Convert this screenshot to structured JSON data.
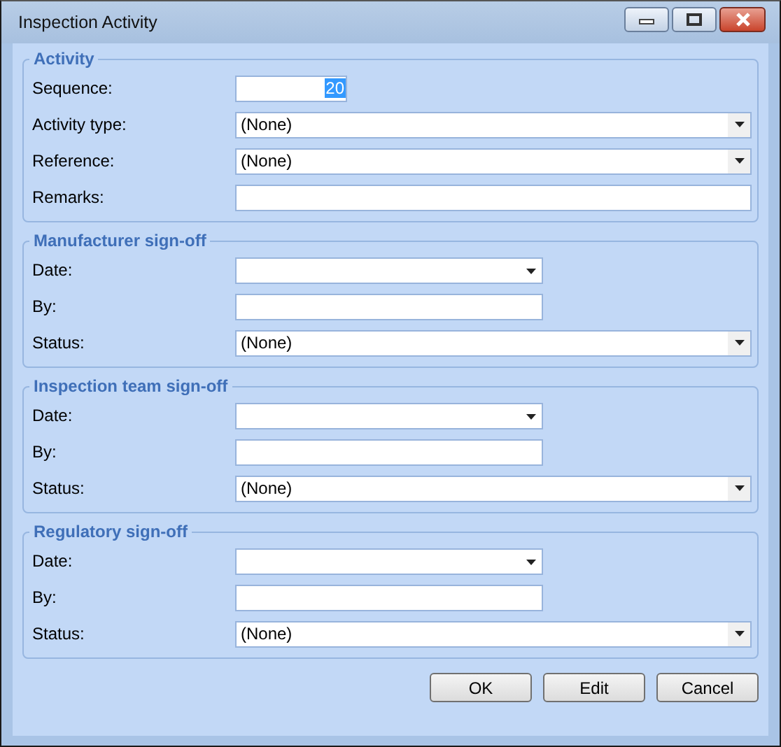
{
  "window": {
    "title": "Inspection Activity"
  },
  "groups": [
    {
      "title": "Activity",
      "fields": [
        {
          "label": "Sequence:",
          "kind": "number",
          "value": "20",
          "value_selected": true
        },
        {
          "label": "Activity type:",
          "kind": "select",
          "value": "(None)"
        },
        {
          "label": "Reference:",
          "kind": "select",
          "value": "(None)"
        },
        {
          "label": "Remarks:",
          "kind": "memo"
        }
      ]
    },
    {
      "title": "Manufacturer sign-off",
      "fields": [
        {
          "label": "Date:",
          "kind": "date"
        },
        {
          "label": "By:",
          "kind": "text"
        },
        {
          "label": "Status:",
          "kind": "select",
          "value": "(None)"
        }
      ]
    },
    {
      "title": "Inspection team sign-off",
      "fields": [
        {
          "label": "Date:",
          "kind": "date"
        },
        {
          "label": "By:",
          "kind": "text"
        },
        {
          "label": "Status:",
          "kind": "select",
          "value": "(None)"
        }
      ]
    },
    {
      "title": "Regulatory sign-off",
      "fields": [
        {
          "label": "Date:",
          "kind": "date"
        },
        {
          "label": "By:",
          "kind": "text"
        },
        {
          "label": "Status:",
          "kind": "select",
          "value": "(None)"
        }
      ]
    }
  ],
  "buttons": [
    "OK",
    "Edit",
    "Cancel"
  ]
}
